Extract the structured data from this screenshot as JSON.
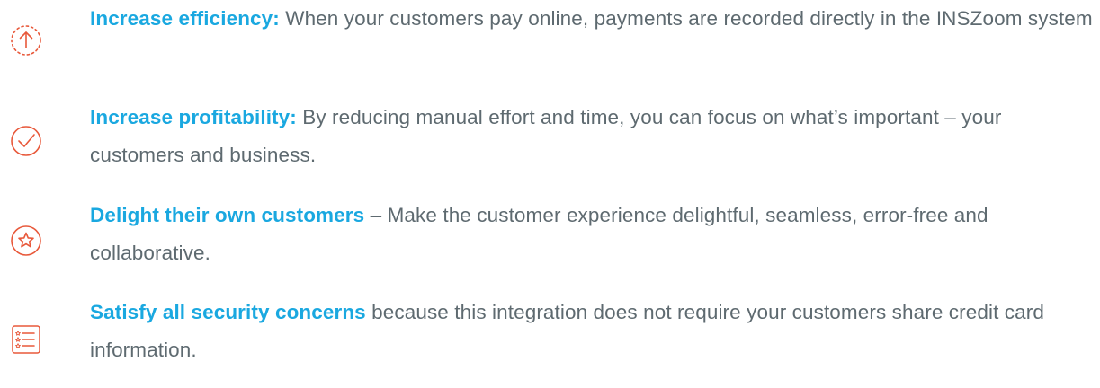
{
  "benefits": [
    {
      "icon": "upload-arrow-icon",
      "lead": "Increase efficiency:",
      "body": " When your customers pay online, payments are recorded directly in the INSZoom system"
    },
    {
      "icon": "check-circle-icon",
      "lead": "Increase profitability:",
      "body": " By reducing manual effort and time, you can focus on what’s important – your customers and business."
    },
    {
      "icon": "star-circle-icon",
      "lead": "Delight their own customers",
      "body": " – Make the customer experience delightful, seamless, error-free and collaborative."
    },
    {
      "icon": "checklist-icon",
      "lead": "Satisfy all security concerns",
      "body": " because this integration does not require your customers share credit card information."
    }
  ],
  "colors": {
    "accent": "#1aa8e0",
    "icon": "#e8583a",
    "text": "#5e6a70"
  }
}
